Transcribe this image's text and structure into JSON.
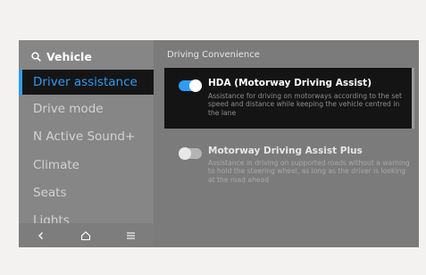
{
  "sidebar": {
    "header_title": "Vehicle",
    "items": [
      {
        "label": "Driver assistance",
        "active": true
      },
      {
        "label": "Drive mode",
        "active": false
      },
      {
        "label": "N Active Sound+",
        "active": false
      },
      {
        "label": "Climate",
        "active": false
      },
      {
        "label": "Seats",
        "active": false
      },
      {
        "label": "Lights",
        "active": false
      }
    ],
    "bottom_icons": [
      "back-icon",
      "home-icon",
      "menu-icon"
    ]
  },
  "main": {
    "section_title": "Driving Convenience",
    "options": [
      {
        "title": "HDA (Motorway Driving Assist)",
        "description": "Assistance for driving on motorways according to the set speed and distance while keeping the vehicle centred in the lane",
        "enabled": true
      },
      {
        "title": "Motorway Driving Assist Plus",
        "description": "Assistance in driving on supported roads without a warning to hold the steering wheel, as long as the driver is looking at the road ahead",
        "enabled": false
      }
    ]
  },
  "colors": {
    "accent": "#2f9cf2",
    "screen_bg": "#7b7b7b",
    "active_bg": "#151515"
  }
}
